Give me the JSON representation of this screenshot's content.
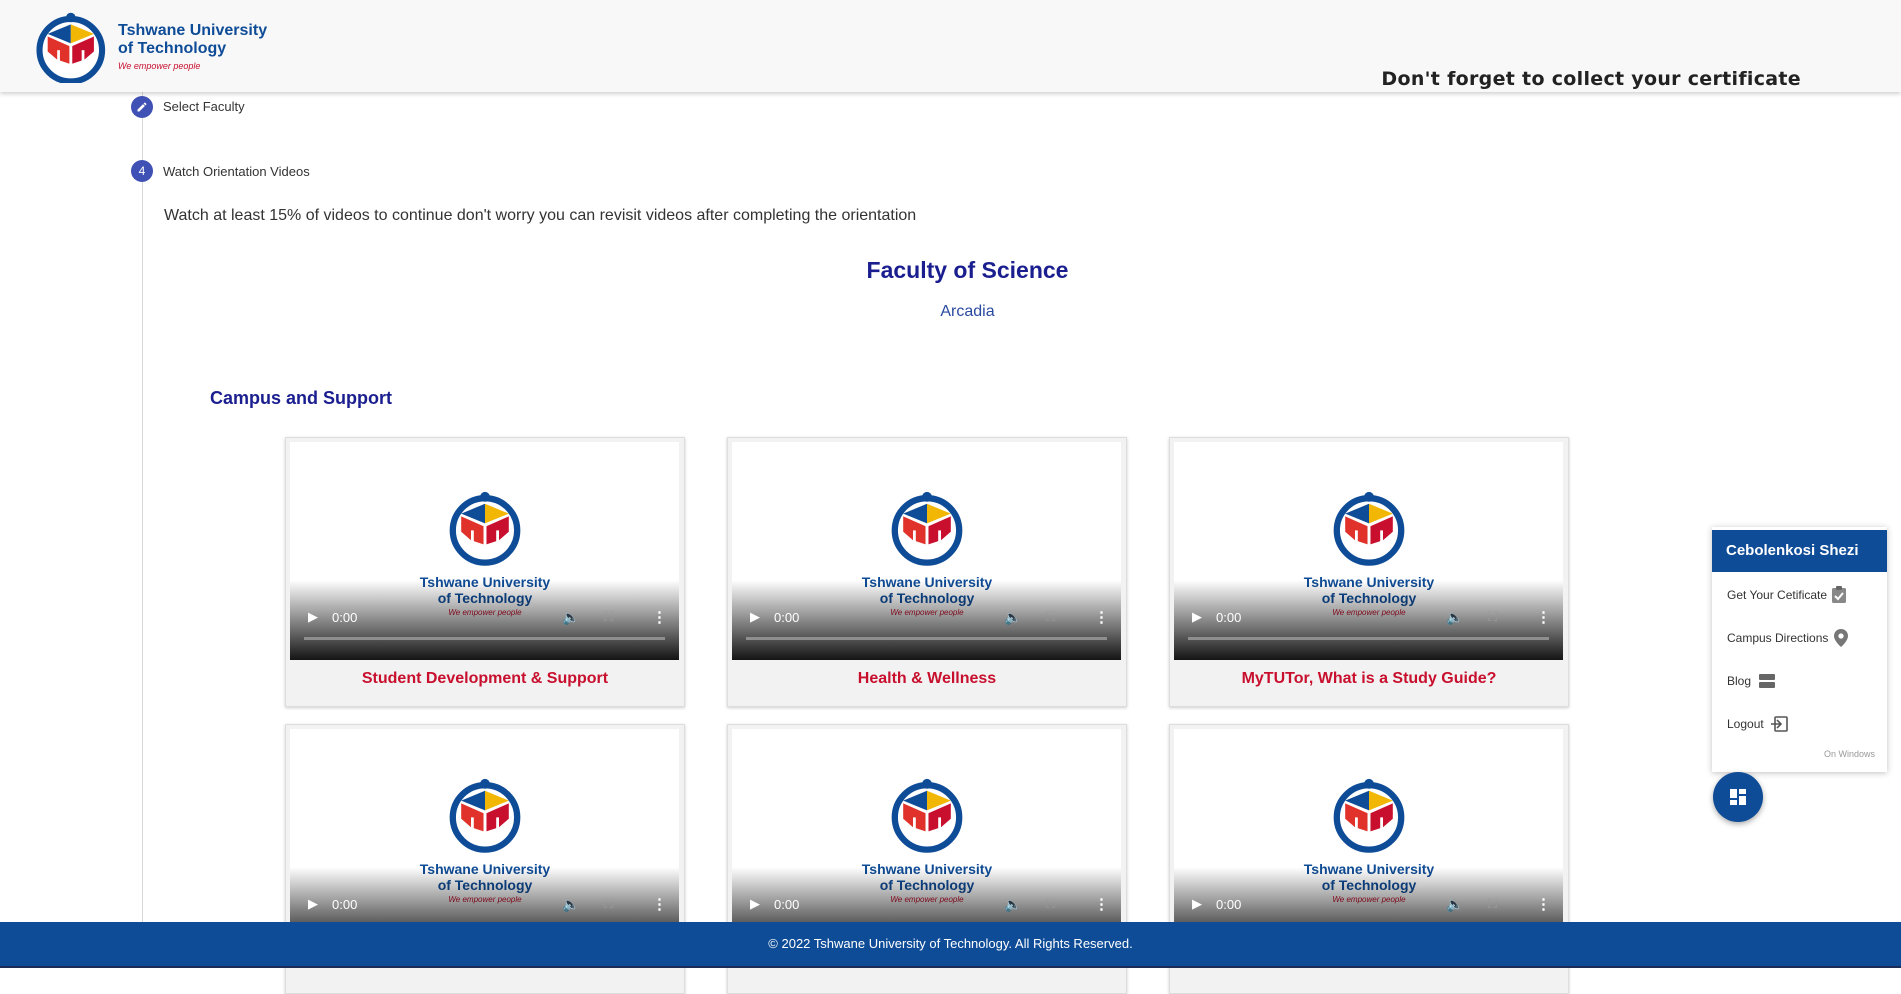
{
  "header": {
    "logo_line1": "Tshwane University",
    "logo_line2": "of Technology",
    "logo_tagline": "We empower people",
    "message": "Don't forget to collect your certificate"
  },
  "steps": {
    "select_faculty": {
      "label": "Select Faculty"
    },
    "watch_videos": {
      "number": "4",
      "label": "Watch Orientation Videos"
    }
  },
  "main": {
    "instructions": "Watch at least 15% of videos to continue don't worry you can revisit videos after completing the orientation",
    "faculty": "Faculty of Science",
    "campus": "Arcadia",
    "section_title": "Campus and Support"
  },
  "videos": [
    {
      "title": "Student Development & Support",
      "time": "0:00"
    },
    {
      "title": "Health & Wellness",
      "time": "0:00"
    },
    {
      "title": "MyTUTor, What is a Study Guide?",
      "time": "0:00"
    },
    {
      "title": "",
      "time": "0:00"
    },
    {
      "title": "",
      "time": "0:00"
    },
    {
      "title": "",
      "time": "0:00"
    }
  ],
  "panel": {
    "user_name": "Cebolenkosi Shezi",
    "items": [
      {
        "label": "Get Your Cetificate",
        "icon": "clipboard-check-icon"
      },
      {
        "label": "Campus Directions",
        "icon": "map-pin-icon"
      },
      {
        "label": "Blog",
        "icon": "blog-icon"
      },
      {
        "label": "Logout",
        "icon": "logout-icon"
      }
    ],
    "note": "On Windows"
  },
  "footer": {
    "copyright": "© 2022 Tshwane University of Technology. All Rights Reserved."
  },
  "colors": {
    "brand_blue": "#0f4c97",
    "title_navy": "#1a1e8f",
    "accent_red": "#c8102e",
    "step_indigo": "#3f51b5"
  }
}
